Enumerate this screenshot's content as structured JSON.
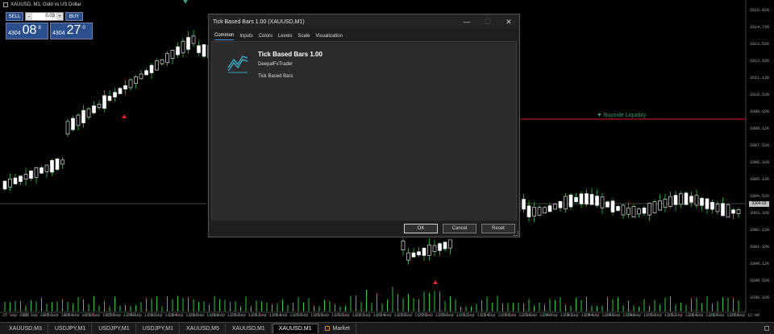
{
  "chart": {
    "symbol_title": "XAUUSD, M1: Gold vs US Dollar",
    "buyside_label": "▼ Buyside Liquidity",
    "current_price": "3304.03",
    "price_axis": [
      "3315.920",
      "3314.720",
      "3313.520",
      "3312.320",
      "3311.120",
      "3310.520",
      "3309.320",
      "3308.120",
      "3307.520",
      "3306.320",
      "3305.120",
      "3304.520",
      "3303.320",
      "3302.120",
      "3301.320",
      "3300.120",
      "3299.520",
      "3298.320"
    ],
    "time_axis": [
      "25 Sep 2025",
      "25 Sep 10:52",
      "25 Sep 10:54",
      "25 Sep 10:56",
      "25 Sep 10:58",
      "25 Sep 11:00",
      "25 Sep 11:02",
      "25 Sep 11:04",
      "25 Sep 11:06",
      "25 Sep 11:08",
      "25 Sep 11:10",
      "25 Sep 11:12",
      "25 Sep 11:14",
      "25 Sep 11:16",
      "25 Sep 11:18",
      "25 Sep 11:20",
      "25 Sep 11:22",
      "25 Sep 11:24",
      "25 Sep 11:26",
      "25 Sep 11:28",
      "25 Sep 11:30",
      "25 Sep 11:32",
      "25 Sep 11:34",
      "25 Sep 11:36",
      "25 Sep 11:38",
      "25 Sep 11:40",
      "25 Sep 11:42",
      "25 Sep 11:44",
      "25 Sep 11:46",
      "25 Sep 11:48",
      "25 Sep 11:50",
      "25 Sep 11:52",
      "25 Sep 11:54",
      "25 Sep 11:56",
      "25 Sep 11:58",
      "25 Sep 12:00"
    ],
    "colors": {
      "bull": "#ffffff",
      "bear": "#ffffff",
      "wick": "#2ecc40",
      "volume": "#2ecc40",
      "liquidity_line": "#e0202a",
      "price_line": "#888888",
      "arrow": "#e0202a"
    }
  },
  "one_click": {
    "sell_label": "SELL",
    "buy_label": "BUY",
    "lot": "0.03",
    "minus": "-",
    "plus": "+",
    "sell_prefix": "4304",
    "sell_big": "08",
    "sell_sup": "8",
    "buy_prefix": "4304",
    "buy_big": "27",
    "buy_sup": "0"
  },
  "dialog": {
    "title": "Tick Based Bars 1.00 (XAUUSD,M1)",
    "tabs": [
      "Common",
      "Inputs",
      "Colors",
      "Levels",
      "Scale",
      "Visualization"
    ],
    "active_tab": "Common",
    "indicator_name": "Tick Based Bars 1.00",
    "author": "DeepalFxTrader",
    "description": "Tick Based Bars",
    "ok_label": "OK",
    "cancel_label": "Cancel",
    "reset_label": "Reset",
    "minimize": "—",
    "maximize": "☐",
    "close": "✕"
  },
  "tabbar": {
    "tabs": [
      "XAUUSD,M3",
      "USDJPY,M1",
      "USDJPY,M1",
      "USDJPY,M1",
      "XAUUSD,M5",
      "XAUUSD,M1",
      "XAUUSD,M1",
      "Market"
    ],
    "active_index": 6
  }
}
